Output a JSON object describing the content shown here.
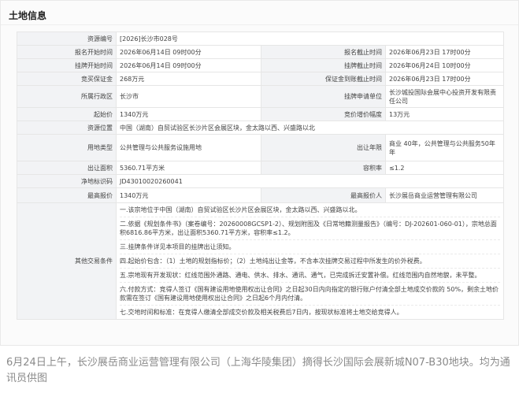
{
  "title": "土地信息",
  "rows": {
    "resource_no": {
      "label": "资源编号",
      "value": "[2026]长沙市028号"
    },
    "apply_start": {
      "label": "报名开始时间",
      "value": "2026年06月14日 09时00分"
    },
    "apply_end": {
      "label": "报名截止时间",
      "value": "2026年06月23日 17时00分"
    },
    "listing_start": {
      "label": "挂牌开始时间",
      "value": "2026年06月14日 09时00分"
    },
    "listing_end": {
      "label": "挂牌截止时间",
      "value": "2026年06月24日 10时00分"
    },
    "deposit": {
      "label": "竞买保证金",
      "value": "268万元"
    },
    "deposit_deadline": {
      "label": "保证金到账截止时间",
      "value": "2026年06月23日 17时00分"
    },
    "district": {
      "label": "所属行政区",
      "value": "长沙市"
    },
    "applicant_unit": {
      "label": "挂牌申请单位",
      "value": "长沙城投国际会展中心投资开发有限责任公司"
    },
    "start_price": {
      "label": "起始价",
      "value": "1340万元"
    },
    "increment": {
      "label": "竞价增价幅度",
      "value": "13万元"
    },
    "location": {
      "label": "资源位置",
      "value": "中国（湖南）自贸试验区长沙片区会展区块，金太路以西、兴盛路以北"
    },
    "use_type": {
      "label": "用地类型",
      "value": "公共管理与公共服务设施用地"
    },
    "term": {
      "label": "出让年限",
      "value": "商业 40年，公共管理与公共服务50年年"
    },
    "area": {
      "label": "出让面积",
      "value": "5360.71平方米"
    },
    "far": {
      "label": "容积率",
      "value": "≤1.2"
    },
    "parcel_code": {
      "label": "净地标识码",
      "value": "JD43010020260041"
    },
    "top_bid": {
      "label": "最高报价",
      "value": "1340万元"
    },
    "top_bidder": {
      "label": "最高报价人",
      "value": "长沙展岳商业运营管理有限公司"
    },
    "other": {
      "label": "其他交易条件"
    }
  },
  "notes": [
    "一.该宗地位于中国（湖南）自贸试验区长沙片区会展区块，金太路以西、兴盛路以北。",
    "二.依据《规划条件书》（案卷编号：20260008GCSP1-2）、规划附图及《日常地籍测量报告》（编号：DJ-202601-060-01），宗地总面积6816.86平方米，出让面积5360.71平方米，容积率≤1.2。",
    "三.挂牌条件详见本项目的挂牌出让须知。",
    "四.起始价包含：（1）土地的规划指标价；（2）土地纯出让金等，不含本次挂牌交易过程中所发生的价外税费。",
    "五.宗地现有开发现状：红线范围外通路、通电、供水、排水、通讯、通气，已完成拆迁安置补偿。红线范围内自然地貌，未平整。",
    "六.付款方式：竞得人签订《国有建设用地使用权出让合同》之日起30日内向指定的银行账户付清全部土地成交价款的 50%，剩余土地价款需在签订《国有建设用地使用权出让合同》之日起6个月内付清。",
    "七.交地时间和标准：在竞得人缴清全部成交价款及相关税费后7日内，按现状标准将土地交给竞得人。"
  ],
  "caption": "6月24日上午，长沙展岳商业运营管理有限公司（上海华陵集团）摘得长沙国际会展新城N07-B30地块。均为通讯员供图"
}
